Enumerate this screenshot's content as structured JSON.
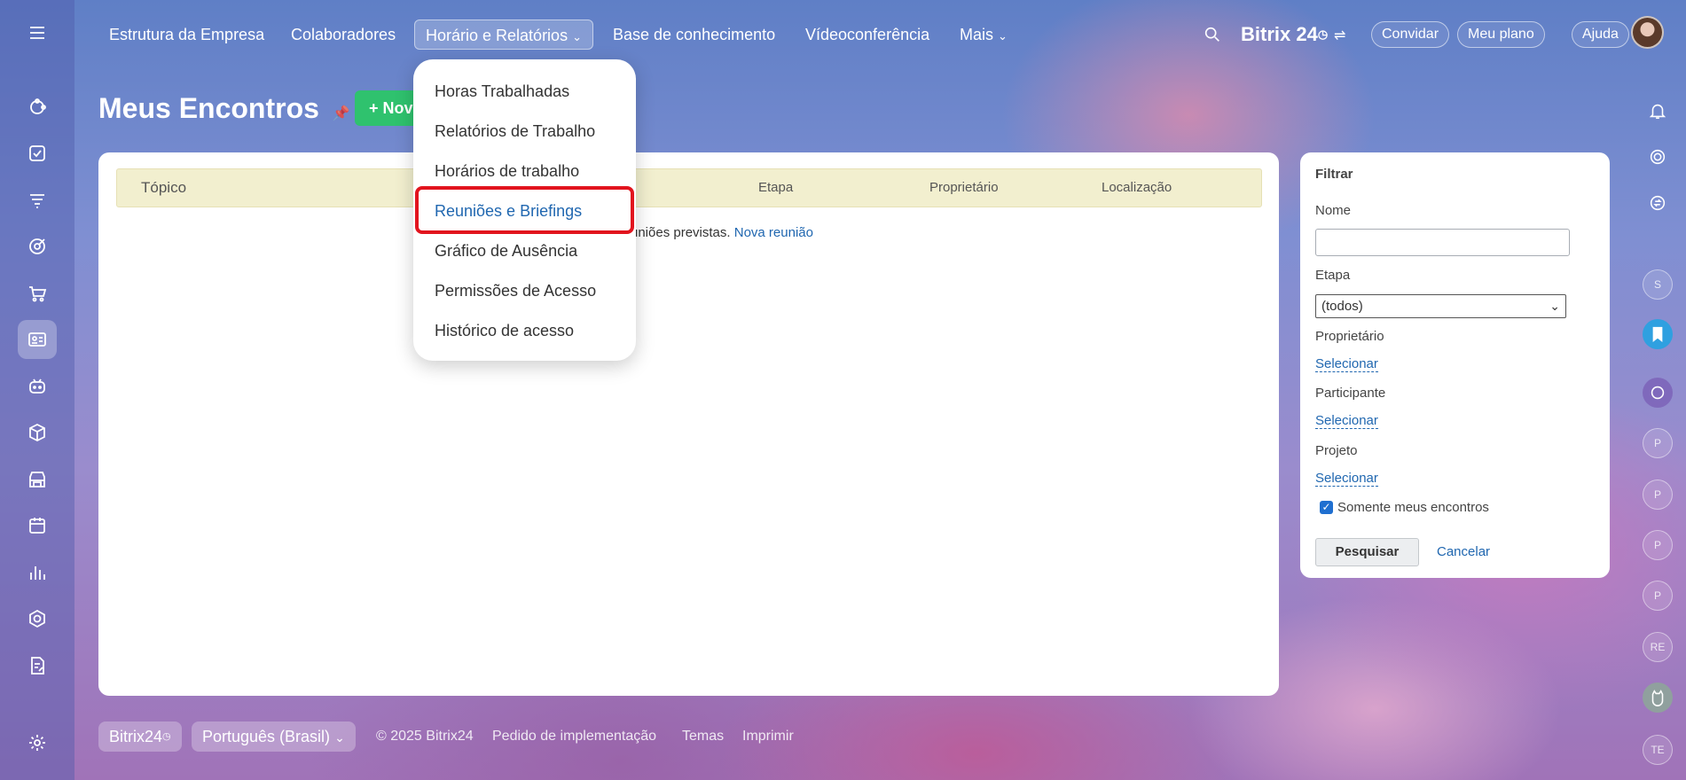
{
  "top_nav": {
    "items": [
      "Estrutura da Empresa",
      "Colaboradores",
      "Horário e Relatórios",
      "Base de conhecimento",
      "Vídeoconferência",
      "Mais"
    ],
    "brand": "Bitrix 24",
    "invite": "Convidar",
    "my_plan": "Meu plano",
    "help": "Ajuda"
  },
  "page": {
    "title": "Meus Encontros",
    "new_button": "+ Nova"
  },
  "dropdown": {
    "items": [
      "Horas Trabalhadas",
      "Relatórios de Trabalho",
      "Horários de trabalho",
      "Reuniões e Briefings",
      "Gráfico de Ausência",
      "Permissões de Acesso",
      "Histórico de acesso"
    ]
  },
  "table": {
    "columns": [
      "Tópico",
      "Etapa",
      "Proprietário",
      "Localização"
    ],
    "empty_text": "uniões previstas.",
    "empty_link": "Nova reunião"
  },
  "filter": {
    "title": "Filtrar",
    "name_label": "Nome",
    "name_value": "",
    "stage_label": "Etapa",
    "stage_value": "(todos)",
    "owner_label": "Proprietário",
    "participant_label": "Participante",
    "project_label": "Projeto",
    "select_link": "Selecionar",
    "only_mine_label": "Somente meus encontros",
    "only_mine_checked": true,
    "search_button": "Pesquisar",
    "cancel_link": "Cancelar"
  },
  "right_rail": {
    "avatars": [
      "S",
      "P",
      "P",
      "P",
      "P",
      "RE",
      "TE"
    ]
  },
  "footer": {
    "brand": "Bitrix24",
    "language": "Português (Brasil)",
    "copyright": "© 2025 Bitrix24",
    "links": [
      "Pedido de implementação",
      "Temas",
      "Imprimir"
    ]
  },
  "colors": {
    "accent": "#2067b0",
    "new_button": "#2fc26e",
    "highlight_border": "#e2141e"
  }
}
